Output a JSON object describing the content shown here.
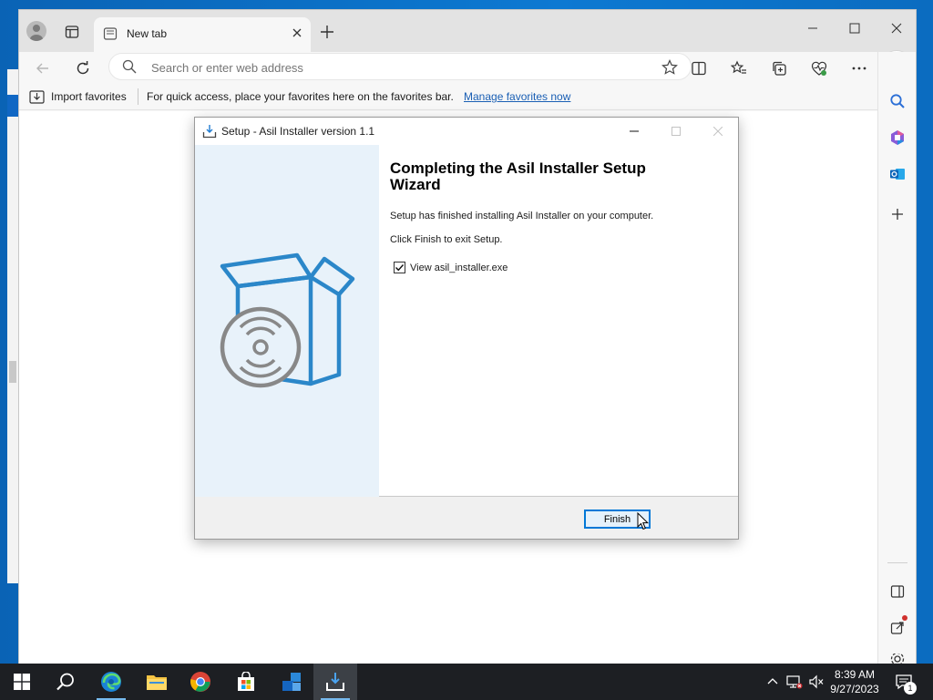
{
  "browser": {
    "tab_title": "New tab",
    "address_placeholder": "Search or enter web address",
    "favbar": {
      "import_label": "Import favorites",
      "message": "For quick access, place your favorites here on the favorites bar.",
      "manage_link": "Manage favorites now"
    },
    "icons": {
      "tabbar": [
        "profile-icon",
        "tab-actions-icon",
        "new-tab-page-icon",
        "close-tab-icon",
        "new-tab-icon",
        "minimize-icon",
        "maximize-icon",
        "close-window-icon"
      ],
      "toolbar": [
        "back-icon",
        "refresh-icon",
        "search-icon",
        "favorite-star-icon",
        "split-screen-icon",
        "favorites-icon",
        "collections-icon",
        "browser-essentials-icon",
        "more-icon",
        "bing-copilot-icon"
      ],
      "sidebar": [
        "search-icon",
        "office-icon",
        "outlook-icon",
        "add-icon",
        "sidebar-toggle-icon",
        "external-link-icon",
        "settings-icon"
      ]
    }
  },
  "dialog": {
    "title": "Setup - Asil Installer version 1.1",
    "heading": "Completing the Asil Installer Setup Wizard",
    "text1": "Setup has finished installing Asil Installer on your computer.",
    "text2": "Click Finish to exit Setup.",
    "checkbox_label": "View asil_installer.exe",
    "checkbox_checked": true,
    "finish_label": "Finish",
    "banner_icon": "software-box-cd-icon"
  },
  "taskbar": {
    "apps": [
      "start-icon",
      "search-icon",
      "edge-icon",
      "file-explorer-icon",
      "chrome-icon",
      "microsoft-store-icon",
      "app-icon",
      "installer-icon"
    ],
    "time": "8:39 AM",
    "date": "9/27/2023",
    "notification_count": "1",
    "accent": "#76b9ed"
  }
}
